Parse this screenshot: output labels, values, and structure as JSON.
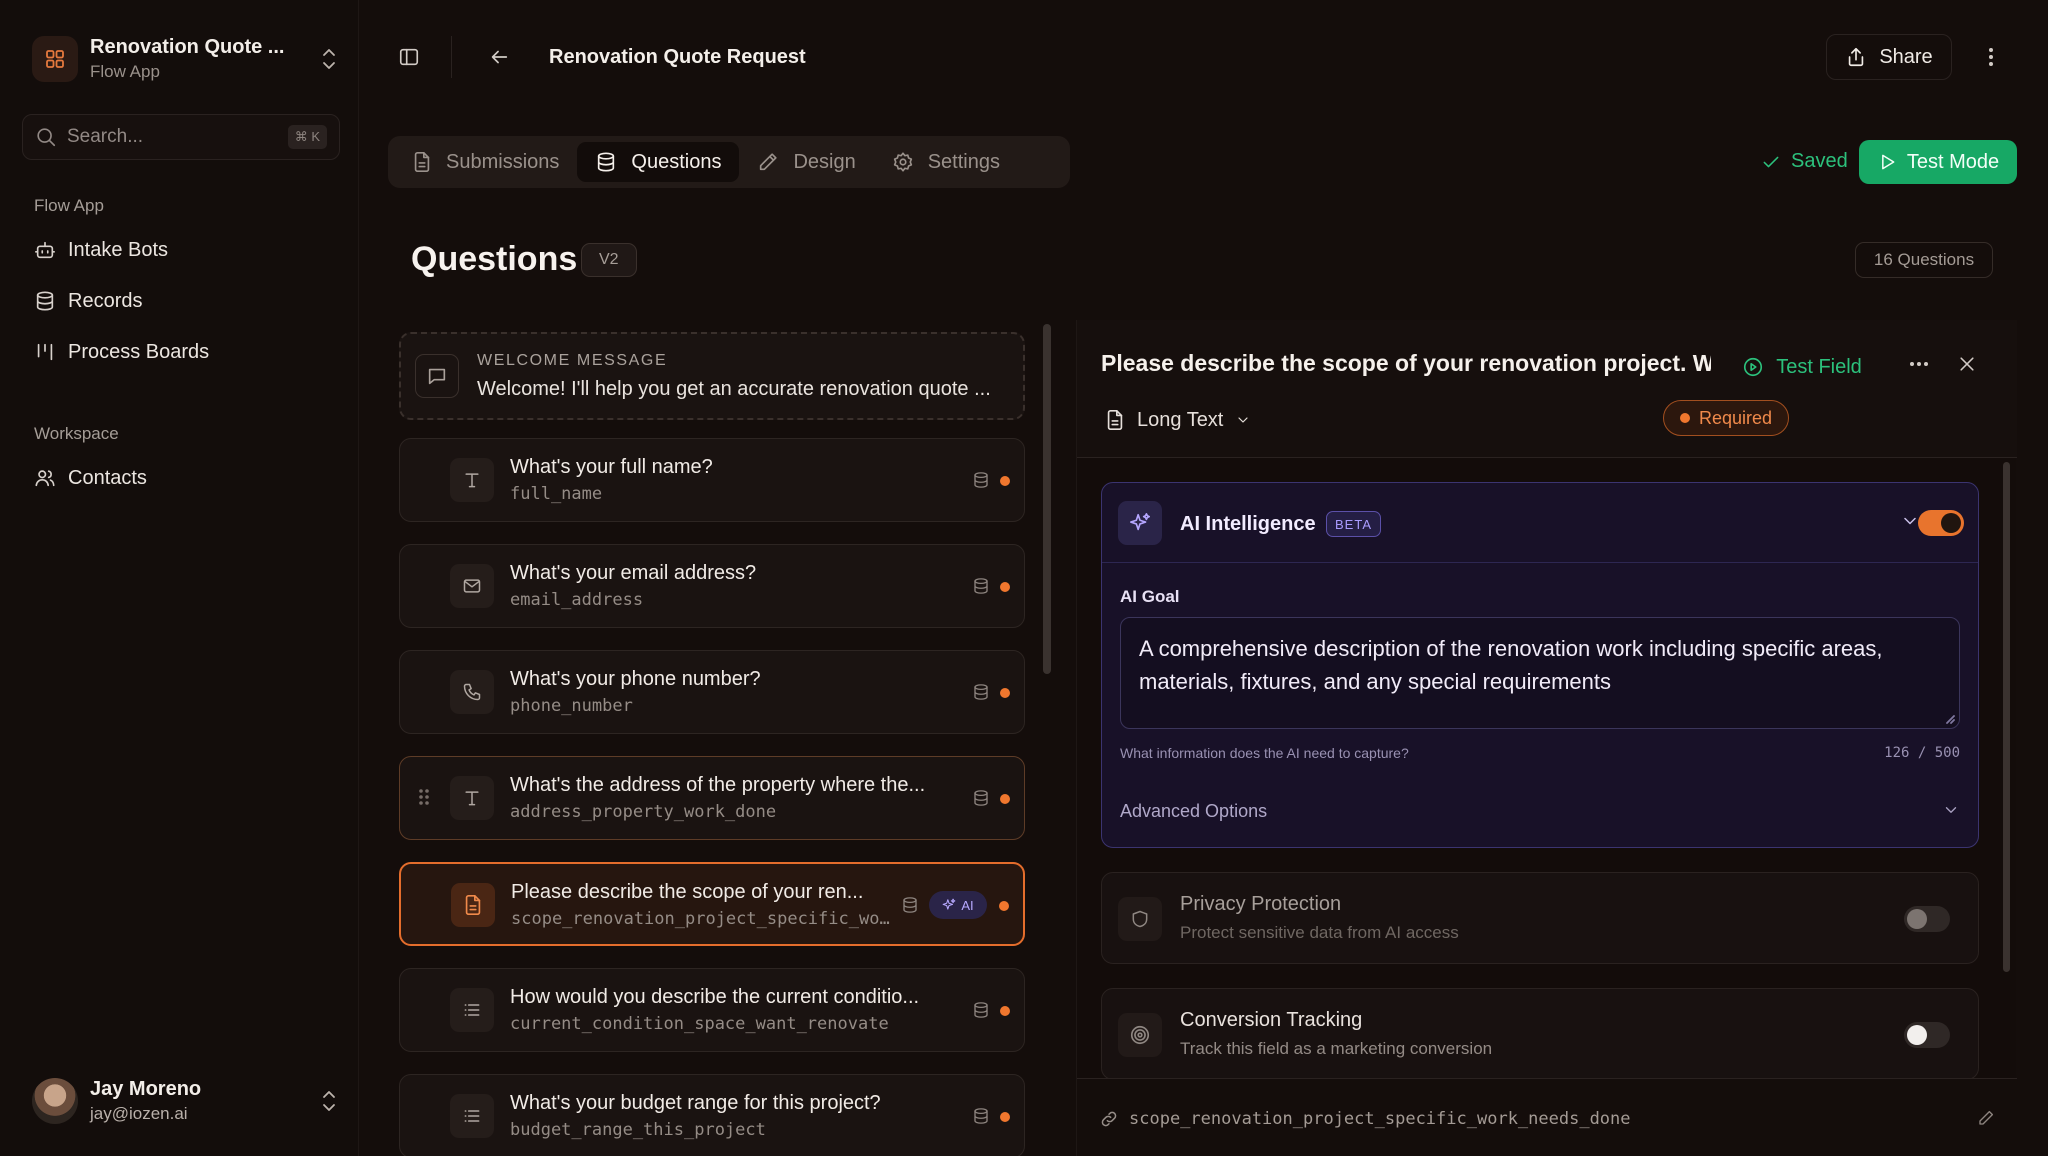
{
  "app": {
    "name": "Renovation Quote ...",
    "subtitle": "Flow App"
  },
  "search": {
    "placeholder": "Search...",
    "shortcut": "⌘ K"
  },
  "sidebar": {
    "sections": [
      {
        "title": "Flow App",
        "items": [
          {
            "label": "Intake Bots",
            "icon": "bot-icon"
          },
          {
            "label": "Records",
            "icon": "database-icon"
          },
          {
            "label": "Process Boards",
            "icon": "kanban-icon"
          }
        ]
      },
      {
        "title": "Workspace",
        "items": [
          {
            "label": "Contacts",
            "icon": "users-icon"
          }
        ]
      }
    ]
  },
  "user": {
    "name": "Jay Moreno",
    "email": "jay@iozen.ai"
  },
  "header": {
    "title": "Renovation Quote Request",
    "share_label": "Share"
  },
  "tabs": [
    {
      "label": "Submissions",
      "icon": "file-icon",
      "active": false
    },
    {
      "label": "Questions",
      "icon": "database-icon",
      "active": true
    },
    {
      "label": "Design",
      "icon": "pencil-icon",
      "active": false
    },
    {
      "label": "Settings",
      "icon": "gear-icon",
      "active": false
    }
  ],
  "status": {
    "saved_label": "Saved",
    "test_mode_label": "Test Mode"
  },
  "questions_page": {
    "heading": "Questions",
    "version": "V2",
    "count_label": "16 Questions"
  },
  "welcome": {
    "label": "WELCOME MESSAGE",
    "text": "Welcome! I'll help you get an accurate renovation quote ..."
  },
  "question_list": [
    {
      "title": "What's your full name?",
      "key": "full_name",
      "type_icon": "text-icon"
    },
    {
      "title": "What's your email address?",
      "key": "email_address",
      "type_icon": "mail-icon"
    },
    {
      "title": "What's your phone number?",
      "key": "phone_number",
      "type_icon": "phone-icon"
    },
    {
      "title": "What's the address of the property where the...",
      "key": "address_property_work_done",
      "type_icon": "text-icon"
    },
    {
      "title": "Please describe the scope of your ren...",
      "key": "scope_renovation_project_specific_wo...",
      "type_icon": "document-icon",
      "ai_label": "AI"
    },
    {
      "title": "How would you describe the current conditio...",
      "key": "current_condition_space_want_renovate",
      "type_icon": "list-icon"
    },
    {
      "title": "What's your budget range for this project?",
      "key": "budget_range_this_project",
      "type_icon": "list-icon"
    }
  ],
  "detail": {
    "question": "Please describe the scope of your renovation project. Wl",
    "test_field_label": "Test Field",
    "field_type": "Long Text",
    "required_label": "Required",
    "ai": {
      "title": "AI Intelligence",
      "badge": "BETA",
      "enabled": true,
      "goal_label": "AI Goal",
      "goal_text": "A comprehensive description of the renovation work including specific areas, materials, fixtures, and any special requirements",
      "help": "What information does the AI need to capture?",
      "char_count": "126 / 500",
      "advanced_label": "Advanced Options"
    },
    "privacy": {
      "title": "Privacy Protection",
      "subtitle": "Protect sensitive data from AI access",
      "enabled": false
    },
    "conversion": {
      "title": "Conversion Tracking",
      "subtitle": "Track this field as a marketing conversion",
      "enabled": false
    },
    "field_key": "scope_renovation_project_specific_work_needs_done"
  },
  "colors": {
    "accent_orange": "#e8742d",
    "success_green": "#17a865",
    "ai_purple": "#b5a6ff"
  }
}
